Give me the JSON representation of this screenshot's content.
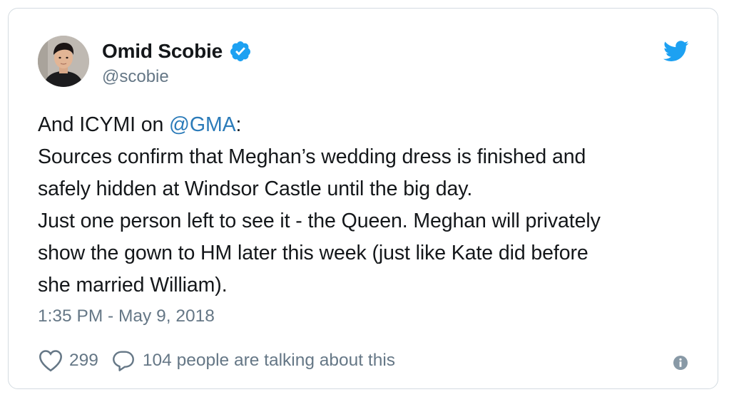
{
  "author": {
    "display_name": "Omid Scobie",
    "handle": "@scobie",
    "verified": true
  },
  "tweet": {
    "lines": [
      {
        "before": "And ICYMI on ",
        "mention": "@GMA",
        "after": ":"
      },
      {
        "text": "Sources confirm that Meghan’s wedding dress is finished and"
      },
      {
        "text": "safely hidden at Windsor Castle until the big day."
      },
      {
        "text": "Just one person left to see it - the Queen. Meghan will privately"
      },
      {
        "text": "show the gown to HM later this week (just like Kate did before"
      },
      {
        "text": "she married William)."
      }
    ],
    "timestamp": "1:35 PM - May 9, 2018"
  },
  "actions": {
    "like_count": "299",
    "talking_text": "104 people are talking about this"
  },
  "icons": {
    "brand": "twitter-bird-icon",
    "verified": "verified-badge-icon",
    "like": "heart-icon",
    "reply": "reply-bubble-icon",
    "info": "info-icon"
  },
  "colors": {
    "brand_blue": "#1da1f2",
    "mention_blue": "#2b7bb9",
    "muted_gray": "#657786",
    "text_dark": "#14171a",
    "border": "#d4dbe1"
  }
}
